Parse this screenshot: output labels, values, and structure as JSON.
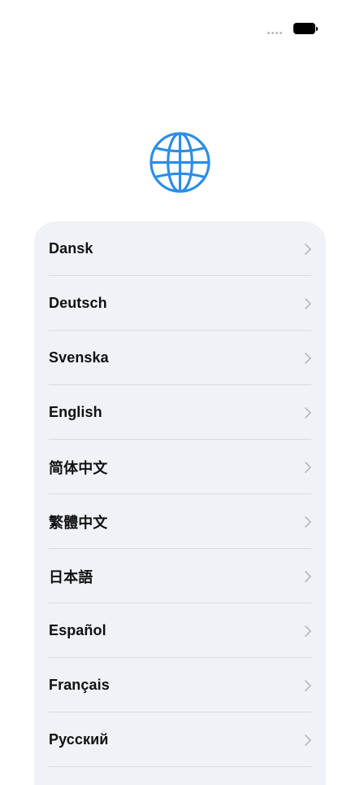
{
  "status_bar": {
    "signal_icon": "cellular-dots-icon",
    "battery_icon": "battery-full-icon"
  },
  "header": {
    "icon": "globe-icon",
    "accent_color": "#2b8de8"
  },
  "languages": [
    {
      "label": "Dansk"
    },
    {
      "label": "Deutsch"
    },
    {
      "label": "Svenska"
    },
    {
      "label": "English"
    },
    {
      "label": "简体中文"
    },
    {
      "label": "繁體中文"
    },
    {
      "label": "日本語"
    },
    {
      "label": "Español"
    },
    {
      "label": "Français"
    },
    {
      "label": "Русский"
    }
  ],
  "row_icon": "chevron-right-icon"
}
